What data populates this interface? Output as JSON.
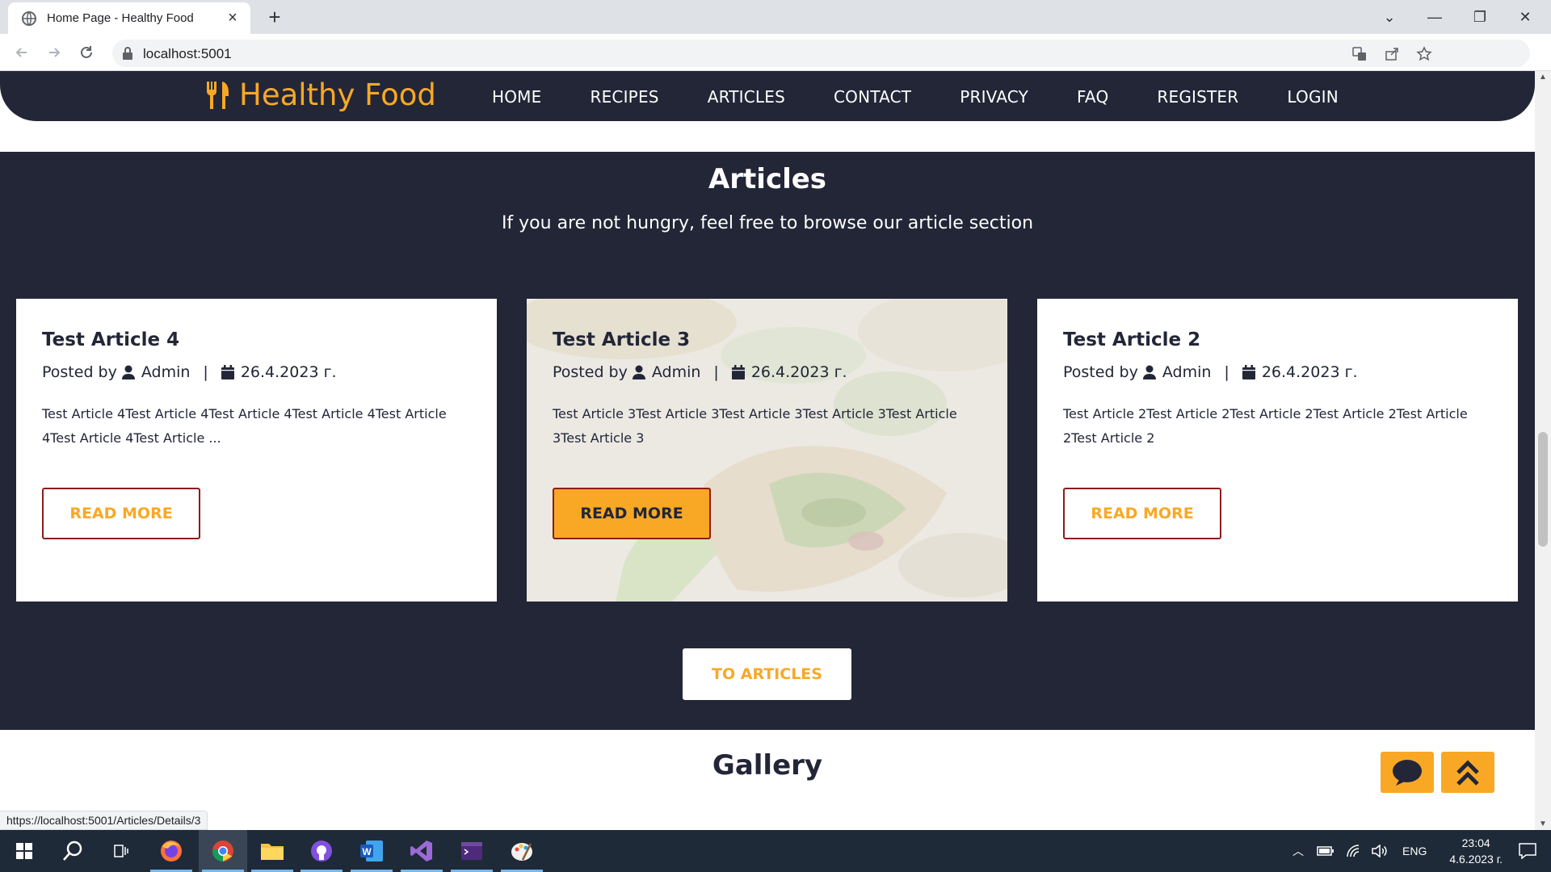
{
  "browser": {
    "tab_title": "Home Page - Healthy Food",
    "url": "localhost:5001",
    "status_url": "https://localhost:5001/Articles/Details/3"
  },
  "site": {
    "brand": "Healthy Food",
    "menu": [
      "HOME",
      "RECIPES",
      "ARTICLES",
      "CONTACT",
      "PRIVACY",
      "FAQ",
      "REGISTER",
      "LOGIN"
    ],
    "colors": {
      "navy": "#222637",
      "accent": "#f9a825",
      "button_border": "#8e1b1b"
    }
  },
  "articles_section": {
    "title": "Articles",
    "subtitle": "If you are not hungry, feel free to browse our article section",
    "cards": [
      {
        "title": "Test Article 4",
        "posted_by_label": "Posted by",
        "author": "Admin",
        "date": "26.4.2023 г.",
        "excerpt": "Test Article 4Test Article 4Test Article 4Test Article 4Test Article 4Test Article 4Test Article ...",
        "button": "READ MORE"
      },
      {
        "title": "Test Article 3",
        "posted_by_label": "Posted by",
        "author": "Admin",
        "date": "26.4.2023 г.",
        "excerpt": "Test Article 3Test Article 3Test Article 3Test Article 3Test Article 3Test Article 3",
        "button": "READ MORE"
      },
      {
        "title": "Test Article 2",
        "posted_by_label": "Posted by",
        "author": "Admin",
        "date": "26.4.2023 г.",
        "excerpt": "Test Article 2Test Article 2Test Article 2Test Article 2Test Article 2Test Article 2",
        "button": "READ MORE"
      }
    ],
    "to_articles": "TO ARTICLES"
  },
  "gallery": {
    "title": "Gallery"
  },
  "taskbar": {
    "apps": [
      "start-icon",
      "search-icon",
      "task-view-icon",
      "firefox-icon",
      "chrome-icon",
      "file-explorer-icon",
      "github-desktop-icon",
      "word-icon",
      "visual-studio-icon",
      "terminal-icon",
      "paint-icon"
    ],
    "language": "ENG",
    "time": "23:04",
    "date": "4.6.2023 г."
  }
}
